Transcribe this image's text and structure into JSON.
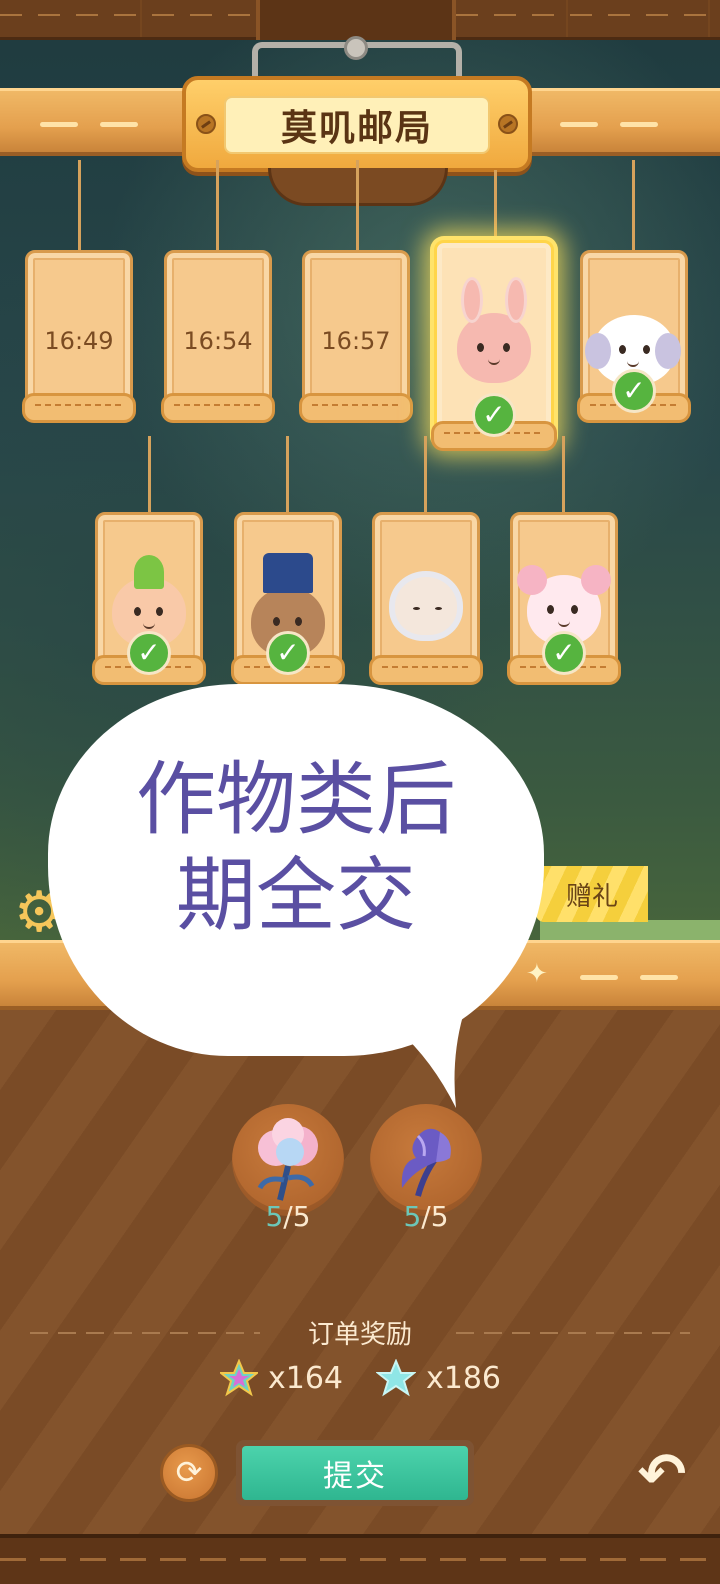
{
  "header": {
    "title": "莫叽邮局"
  },
  "orders_row1": [
    {
      "time": "16:49",
      "completed": false
    },
    {
      "time": "16:54",
      "completed": false
    },
    {
      "time": "16:57",
      "completed": false
    },
    {
      "character": "bunny-clown-icon",
      "completed": true,
      "selected": true
    },
    {
      "character": "white-puppy-icon",
      "completed": true
    }
  ],
  "orders_row2": [
    {
      "character": "deer-elf-icon",
      "completed": true
    },
    {
      "character": "mouse-conductor-icon",
      "completed": true
    },
    {
      "character": "silver-hair-girl-icon",
      "completed": false
    },
    {
      "character": "pink-mouse-icon",
      "completed": true
    }
  ],
  "bubble": {
    "line1": "作物类后",
    "line2": "期全交"
  },
  "gift_tab": {
    "label": "赠礼"
  },
  "items": [
    {
      "name": "pink-cotton-flower-icon",
      "have": "5",
      "need": "/5"
    },
    {
      "name": "purple-coral-flower-icon",
      "have": "5",
      "need": "/5"
    }
  ],
  "rewards": {
    "title": "订单奖励",
    "star_coin": "x164",
    "star_crystal": "x186"
  },
  "actions": {
    "submit": "提交"
  },
  "colors": {
    "accent": "#2fb690",
    "bubble_text": "#5a4fa2",
    "check": "#56b43f"
  }
}
